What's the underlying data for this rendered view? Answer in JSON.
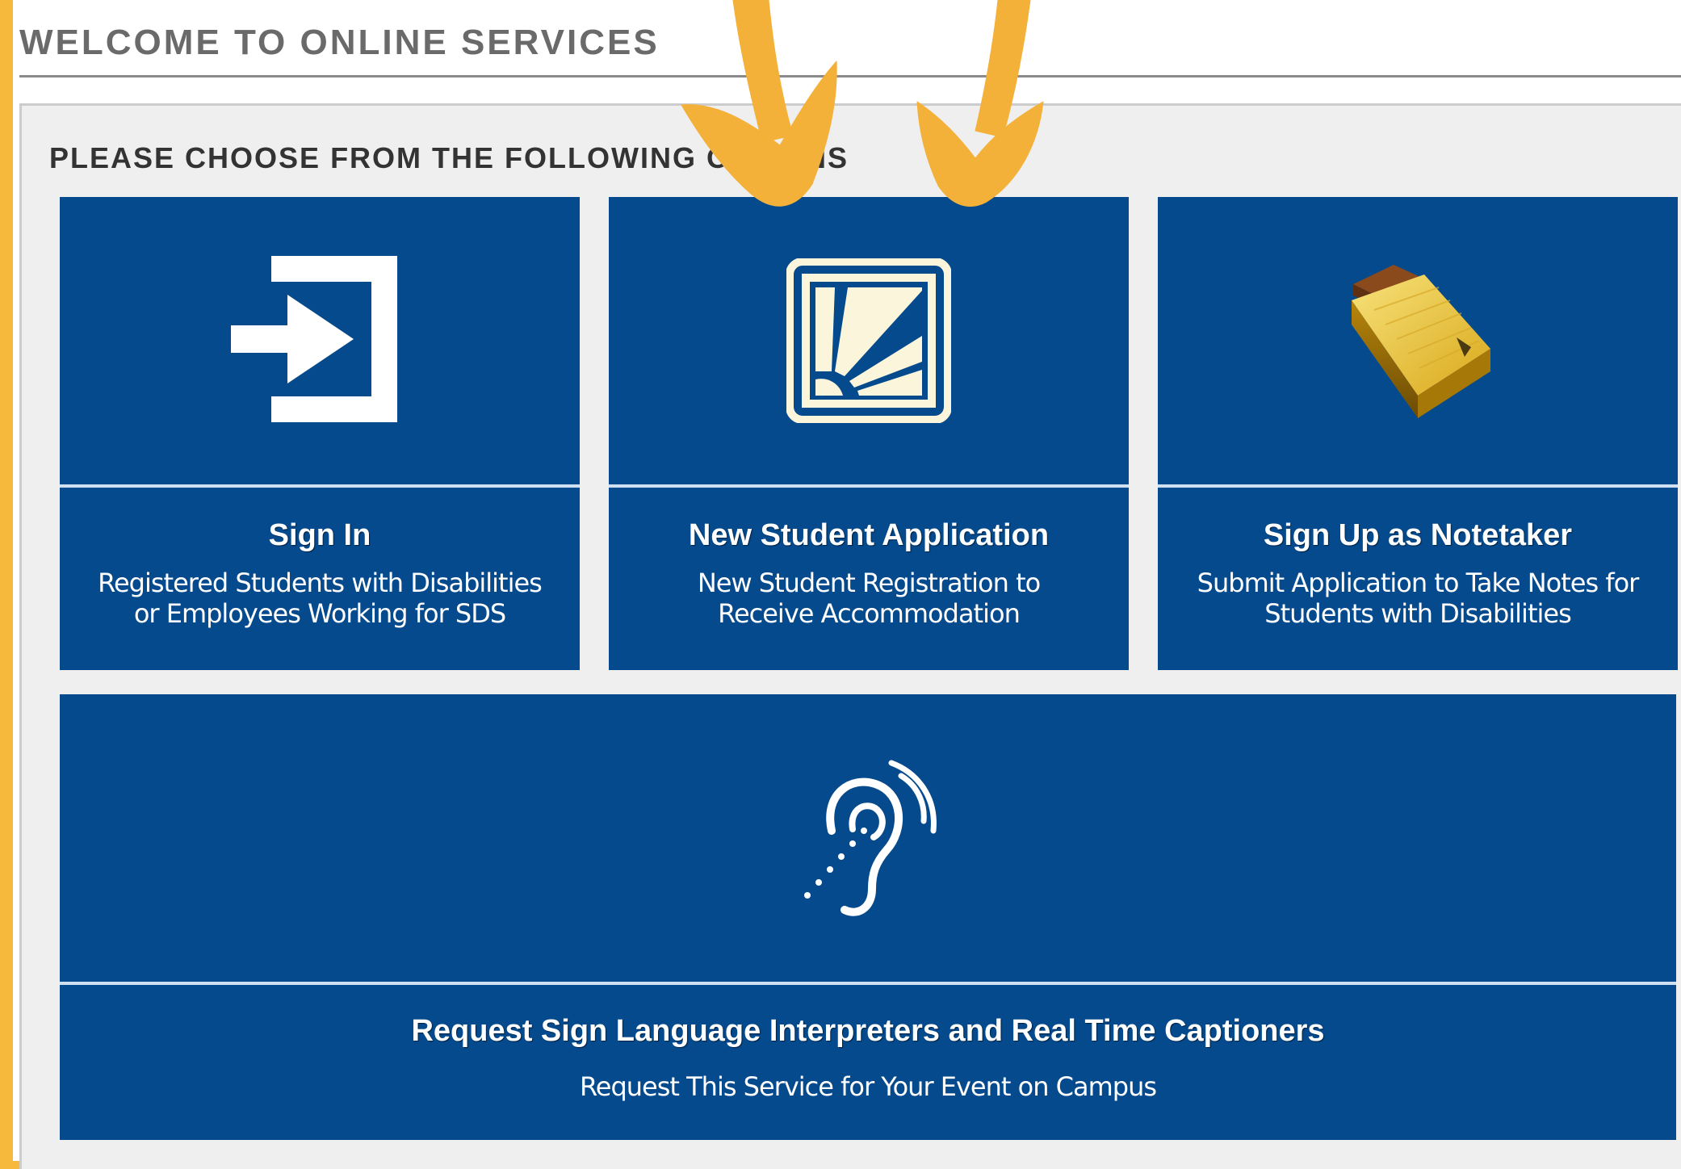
{
  "header": {
    "title": "WELCOME TO ONLINE SERVICES"
  },
  "panel": {
    "subtitle": "PLEASE CHOOSE FROM THE FOLLOWING OPTIONS"
  },
  "tiles": [
    {
      "heading": "Sign In",
      "description": "Registered Students with Disabilities or Employees Working for SDS",
      "icon": "sign-in-icon"
    },
    {
      "heading": "New Student Application",
      "description": "New Student Registration to Receive Accommodation",
      "icon": "application-icon"
    },
    {
      "heading": "Sign Up as Notetaker",
      "description": "Submit Application to Take Notes for Students with Disabilities",
      "icon": "notepad-icon"
    },
    {
      "heading": "Request Sign Language Interpreters and Real Time Captioners",
      "description": "Request This Service for Your Event on Campus",
      "icon": "hearing-assistance-icon"
    }
  ],
  "colors": {
    "frame": "#f6b93b",
    "tile": "#054a8d",
    "arrow": "#f4b13a"
  }
}
